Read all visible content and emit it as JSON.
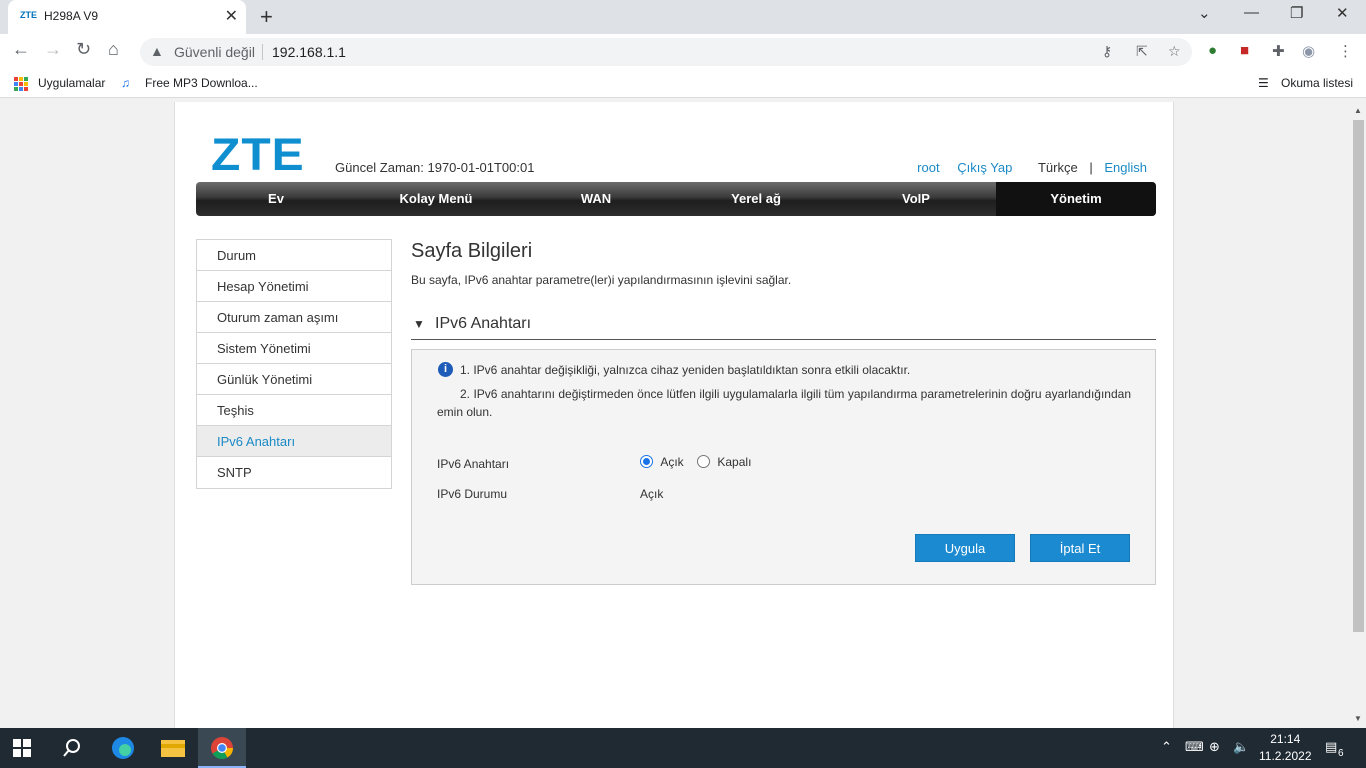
{
  "browser": {
    "tab_favicon": "ZTE",
    "tab_title": "H298A V9",
    "not_secure": "Güvenli değil",
    "url": "192.168.1.1",
    "bookmarks": [
      "Uygulamalar",
      "Free MP3 Downloa..."
    ],
    "reading_list": "Okuma listesi"
  },
  "header": {
    "logo": "ZTE",
    "current_time": "Güncel Zaman: 1970-01-01T00:01",
    "user": "root",
    "logout": "Çıkış Yap",
    "lang_tr": "Türkçe",
    "lang_sep": "|",
    "lang_en": "English"
  },
  "mainnav": [
    "Ev",
    "Kolay Menü",
    "WAN",
    "Yerel ağ",
    "VoIP",
    "Yönetim"
  ],
  "sidemenu": [
    "Durum",
    "Hesap Yönetimi",
    "Oturum zaman aşımı",
    "Sistem Yönetimi",
    "Günlük Yönetimi",
    "Teşhis",
    "IPv6 Anahtarı",
    "SNTP"
  ],
  "content": {
    "title": "Sayfa Bilgileri",
    "description": "Bu sayfa, IPv6 anahtar parametre(ler)i yapılandırmasının işlevini sağlar.",
    "section_title": "IPv6 Anahtarı",
    "note1": "1. IPv6 anahtar değişikliği, yalnızca cihaz yeniden başlatıldıktan sonra etkili olacaktır.",
    "note2": "2. IPv6 anahtarını değiştirmeden önce lütfen ilgili uygulamalarla ilgili tüm yapılandırma parametrelerinin doğru ayarlandığından emin olun.",
    "switch_label": "IPv6 Anahtarı",
    "option_on": "Açık",
    "option_off": "Kapalı",
    "status_label": "IPv6 Durumu",
    "status_value": "Açık",
    "apply": "Uygula",
    "cancel": "İptal Et"
  },
  "taskbar": {
    "time": "21:14",
    "date": "11.2.2022",
    "notifications": "6"
  }
}
